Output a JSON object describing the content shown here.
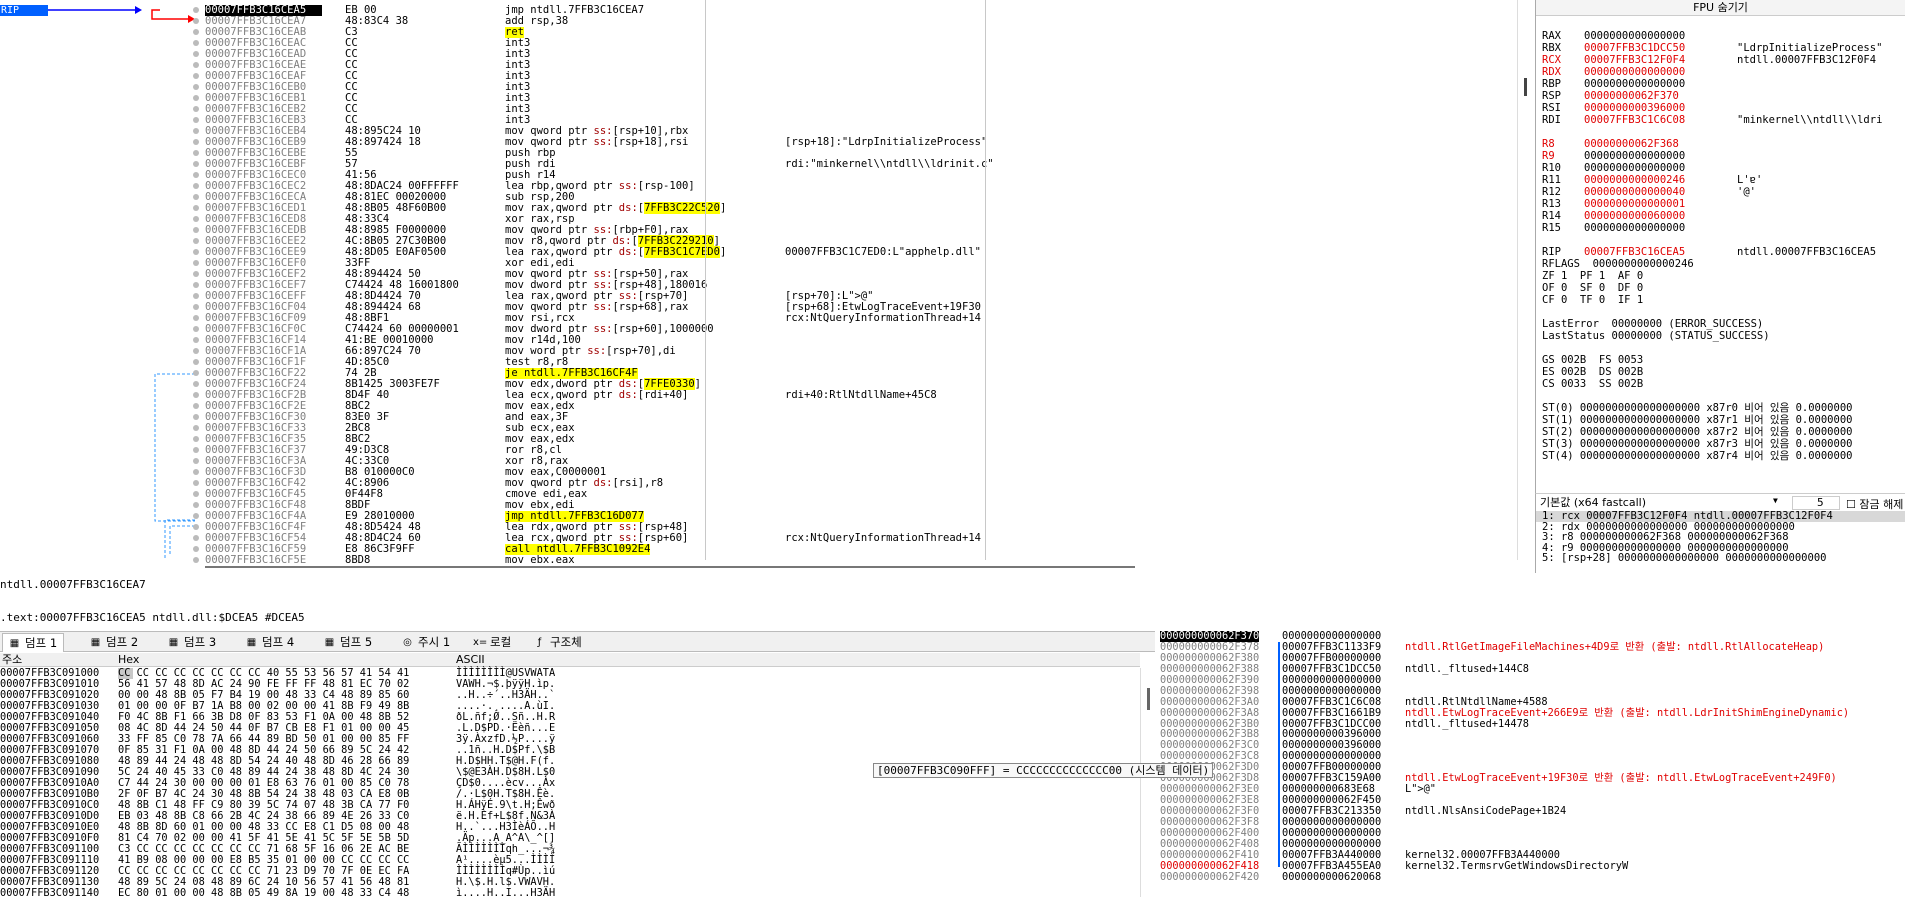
{
  "disasm": {
    "eip_label": "RIP",
    "rows": [
      {
        "addr": "00007FFB3C16CEA5",
        "bytes": "EB 00",
        "instr": "jmp ntdll.7FFB3C16CEA7",
        "cmt": "",
        "cur": true,
        "hl": ""
      },
      {
        "addr": "00007FFB3C16CEA7",
        "bytes": "48:83C4 38",
        "instr": "add rsp,38",
        "cmt": "",
        "hl": ""
      },
      {
        "addr": "00007FFB3C16CEAB",
        "bytes": "C3",
        "instr": "ret",
        "cmt": "",
        "hl": "ret"
      },
      {
        "addr": "00007FFB3C16CEAC",
        "bytes": "CC",
        "instr": "int3",
        "cmt": "",
        "hl": ""
      },
      {
        "addr": "00007FFB3C16CEAD",
        "bytes": "CC",
        "instr": "int3",
        "cmt": "",
        "hl": ""
      },
      {
        "addr": "00007FFB3C16CEAE",
        "bytes": "CC",
        "instr": "int3",
        "cmt": "",
        "hl": ""
      },
      {
        "addr": "00007FFB3C16CEAF",
        "bytes": "CC",
        "instr": "int3",
        "cmt": "",
        "hl": ""
      },
      {
        "addr": "00007FFB3C16CEB0",
        "bytes": "CC",
        "instr": "int3",
        "cmt": "",
        "hl": ""
      },
      {
        "addr": "00007FFB3C16CEB1",
        "bytes": "CC",
        "instr": "int3",
        "cmt": "",
        "hl": ""
      },
      {
        "addr": "00007FFB3C16CEB2",
        "bytes": "CC",
        "instr": "int3",
        "cmt": "",
        "hl": ""
      },
      {
        "addr": "00007FFB3C16CEB3",
        "bytes": "CC",
        "instr": "int3",
        "cmt": "",
        "hl": ""
      },
      {
        "addr": "00007FFB3C16CEB4",
        "bytes": "48:895C24 10",
        "instr": "mov qword ptr ss:[rsp+10],rbx",
        "cmt": "",
        "hl": ""
      },
      {
        "addr": "00007FFB3C16CEB9",
        "bytes": "48:897424 18",
        "instr": "mov qword ptr ss:[rsp+18],rsi",
        "cmt": "[rsp+18]:\"LdrpInitializeProcess\"",
        "hl": ""
      },
      {
        "addr": "00007FFB3C16CEBE",
        "bytes": "55",
        "instr": "push rbp",
        "cmt": "",
        "hl": ""
      },
      {
        "addr": "00007FFB3C16CEBF",
        "bytes": "57",
        "instr": "push rdi",
        "cmt": "rdi:\"minkernel\\\\ntdll\\\\ldrinit.c\"",
        "hl": ""
      },
      {
        "addr": "00007FFB3C16CEC0",
        "bytes": "41:56",
        "instr": "push r14",
        "cmt": "",
        "hl": ""
      },
      {
        "addr": "00007FFB3C16CEC2",
        "bytes": "48:8DAC24 00FFFFFF",
        "instr": "lea rbp,qword ptr ss:[rsp-100]",
        "cmt": "",
        "hl": ""
      },
      {
        "addr": "00007FFB3C16CECA",
        "bytes": "48:81EC 00020000",
        "instr": "sub rsp,200",
        "cmt": "",
        "hl": ""
      },
      {
        "addr": "00007FFB3C16CED1",
        "bytes": "48:8B05 48F60B00",
        "instr": "mov rax,qword ptr ds:[7FFB3C22C520]",
        "cmt": "",
        "hl": ""
      },
      {
        "addr": "00007FFB3C16CED8",
        "bytes": "48:33C4",
        "instr": "xor rax,rsp",
        "cmt": "",
        "hl": ""
      },
      {
        "addr": "00007FFB3C16CEDB",
        "bytes": "48:8985 F0000000",
        "instr": "mov qword ptr ss:[rbp+F0],rax",
        "cmt": "",
        "hl": ""
      },
      {
        "addr": "00007FFB3C16CEE2",
        "bytes": "4C:8B05 27C30B00",
        "instr": "mov r8,qword ptr ds:[7FFB3C229210]",
        "cmt": "",
        "hl": ""
      },
      {
        "addr": "00007FFB3C16CEE9",
        "bytes": "48:8D05 E0AF0500",
        "instr": "lea rax,qword ptr ds:[7FFB3C1C7ED0]",
        "cmt": "00007FFB3C1C7ED0:L\"apphelp.dll\"",
        "hl": ""
      },
      {
        "addr": "00007FFB3C16CEF0",
        "bytes": "33FF",
        "instr": "xor edi,edi",
        "cmt": "",
        "hl": ""
      },
      {
        "addr": "00007FFB3C16CEF2",
        "bytes": "48:894424 50",
        "instr": "mov qword ptr ss:[rsp+50],rax",
        "cmt": "",
        "hl": ""
      },
      {
        "addr": "00007FFB3C16CEF7",
        "bytes": "C74424 48 16001800",
        "instr": "mov dword ptr ss:[rsp+48],180016",
        "cmt": "",
        "hl": ""
      },
      {
        "addr": "00007FFB3C16CEFF",
        "bytes": "48:8D4424 70",
        "instr": "lea rax,qword ptr ss:[rsp+70]",
        "cmt": "[rsp+70]:L\">@\"",
        "hl": ""
      },
      {
        "addr": "00007FFB3C16CF04",
        "bytes": "48:894424 68",
        "instr": "mov qword ptr ss:[rsp+68],rax",
        "cmt": "[rsp+68]:EtwLogTraceEvent+19F30",
        "hl": ""
      },
      {
        "addr": "00007FFB3C16CF09",
        "bytes": "48:8BF1",
        "instr": "mov rsi,rcx",
        "cmt": "rcx:NtQueryInformationThread+14",
        "hl": ""
      },
      {
        "addr": "00007FFB3C16CF0C",
        "bytes": "C74424 60 00000001",
        "instr": "mov dword ptr ss:[rsp+60],1000000",
        "cmt": "",
        "hl": ""
      },
      {
        "addr": "00007FFB3C16CF14",
        "bytes": "41:BE 00010000",
        "instr": "mov r14d,100",
        "cmt": "",
        "hl": ""
      },
      {
        "addr": "00007FFB3C16CF1A",
        "bytes": "66:897C24 70",
        "instr": "mov word ptr ss:[rsp+70],di",
        "cmt": "",
        "hl": ""
      },
      {
        "addr": "00007FFB3C16CF1F",
        "bytes": "4D:85C0",
        "instr": "test r8,r8",
        "cmt": "",
        "hl": ""
      },
      {
        "addr": "00007FFB3C16CF22",
        "bytes": "74 2B",
        "instr": "je ntdll.7FFB3C16CF4F",
        "cmt": "",
        "hl": "je"
      },
      {
        "addr": "00007FFB3C16CF24",
        "bytes": "8B1425 3003FE7F",
        "instr": "mov edx,dword ptr ds:[7FFE0330]",
        "cmt": "",
        "hl": ""
      },
      {
        "addr": "00007FFB3C16CF2B",
        "bytes": "8D4F 40",
        "instr": "lea ecx,qword ptr ds:[rdi+40]",
        "cmt": "rdi+40:RtlNtdllName+45C8",
        "hl": ""
      },
      {
        "addr": "00007FFB3C16CF2E",
        "bytes": "8BC2",
        "instr": "mov eax,edx",
        "cmt": "",
        "hl": ""
      },
      {
        "addr": "00007FFB3C16CF30",
        "bytes": "83E0 3F",
        "instr": "and eax,3F",
        "cmt": "",
        "hl": ""
      },
      {
        "addr": "00007FFB3C16CF33",
        "bytes": "2BC8",
        "instr": "sub ecx,eax",
        "cmt": "",
        "hl": ""
      },
      {
        "addr": "00007FFB3C16CF35",
        "bytes": "8BC2",
        "instr": "mov eax,edx",
        "cmt": "",
        "hl": ""
      },
      {
        "addr": "00007FFB3C16CF37",
        "bytes": "49:D3C8",
        "instr": "ror r8,cl",
        "cmt": "",
        "hl": ""
      },
      {
        "addr": "00007FFB3C16CF3A",
        "bytes": "4C:33C0",
        "instr": "xor r8,rax",
        "cmt": "",
        "hl": ""
      },
      {
        "addr": "00007FFB3C16CF3D",
        "bytes": "B8 010000C0",
        "instr": "mov eax,C0000001",
        "cmt": "",
        "hl": ""
      },
      {
        "addr": "00007FFB3C16CF42",
        "bytes": "4C:8906",
        "instr": "mov qword ptr ds:[rsi],r8",
        "cmt": "",
        "hl": ""
      },
      {
        "addr": "00007FFB3C16CF45",
        "bytes": "0F44F8",
        "instr": "cmove edi,eax",
        "cmt": "",
        "hl": ""
      },
      {
        "addr": "00007FFB3C16CF48",
        "bytes": "8BDF",
        "instr": "mov ebx,edi",
        "cmt": "",
        "hl": ""
      },
      {
        "addr": "00007FFB3C16CF4A",
        "bytes": "E9 28010000",
        "instr": "jmp ntdll.7FFB3C16D077",
        "cmt": "",
        "hl": "jmp"
      },
      {
        "addr": "00007FFB3C16CF4F",
        "bytes": "48:8D5424 48",
        "instr": "lea rdx,qword ptr ss:[rsp+48]",
        "cmt": "",
        "hl": ""
      },
      {
        "addr": "00007FFB3C16CF54",
        "bytes": "48:8D4C24 60",
        "instr": "lea rcx,qword ptr ss:[rsp+60]",
        "cmt": "rcx:NtQueryInformationThread+14",
        "hl": ""
      },
      {
        "addr": "00007FFB3C16CF59",
        "bytes": "E8 86C3F9FF",
        "instr": "call ntdll.7FFB3C1092E4",
        "cmt": "",
        "hl": "call"
      },
      {
        "addr": "00007FFB3C16CF5E",
        "bytes": "8BD8",
        "instr": "mov ebx,eax",
        "cmt": "",
        "hl": ""
      }
    ]
  },
  "info": {
    "line1": "ntdll.00007FFB3C16CEA7",
    "line2": ".text:00007FFB3C16CEA5 ntdll.dll:$DCEA5 #DCEA5"
  },
  "regs": {
    "title": "FPU 숨기기",
    "rows": [
      {
        "n": "RAX",
        "v": "0000000000000000",
        "c": "",
        "red": false
      },
      {
        "n": "RBX",
        "v": "00007FFB3C1DCC50",
        "c": "\"LdrpInitializeProcess\"",
        "red": true
      },
      {
        "n": "RCX",
        "v": "00007FFB3C12F0F4",
        "c": "ntdll.00007FFB3C12F0F4",
        "red": true,
        "nred": true
      },
      {
        "n": "RDX",
        "v": "0000000000000000",
        "c": "",
        "red": true,
        "nred": true
      },
      {
        "n": "RBP",
        "v": "0000000000000000",
        "c": "",
        "red": false
      },
      {
        "n": "RSP",
        "v": "00000000062F370",
        "c": "",
        "red": true
      },
      {
        "n": "RSI",
        "v": "0000000000396000",
        "c": "",
        "red": true
      },
      {
        "n": "RDI",
        "v": "00007FFB3C1C6C08",
        "c": "\"minkernel\\\\ntdll\\\\ldri",
        "red": true
      },
      {
        "n": "",
        "v": "",
        "c": ""
      },
      {
        "n": "R8",
        "v": "00000000062F368",
        "c": "",
        "red": true,
        "nred": true
      },
      {
        "n": "R9",
        "v": "0000000000000000",
        "c": "",
        "red": false,
        "nred": true
      },
      {
        "n": "R10",
        "v": "0000000000000000",
        "c": "",
        "red": false
      },
      {
        "n": "R11",
        "v": "0000000000000246",
        "c": "L'ɐ'",
        "red": true
      },
      {
        "n": "R12",
        "v": "0000000000000040",
        "c": "'@'",
        "red": true
      },
      {
        "n": "R13",
        "v": "0000000000000001",
        "c": "",
        "red": true
      },
      {
        "n": "R14",
        "v": "0000000000060000",
        "c": "",
        "red": true
      },
      {
        "n": "R15",
        "v": "0000000000000000",
        "c": "",
        "red": false
      },
      {
        "n": "",
        "v": "",
        "c": ""
      },
      {
        "n": "RIP",
        "v": "00007FFB3C16CEA5",
        "c": "ntdll.00007FFB3C16CEA5",
        "red": true
      }
    ],
    "flags": [
      "RFLAGS  0000000000000246",
      "ZF 1  PF 1  AF 0",
      "OF 0  SF 0  DF 0",
      "CF 0  TF 0  IF 1",
      "",
      "LastError  00000000 (ERROR_SUCCESS)",
      "LastStatus 00000000 (STATUS_SUCCESS)",
      "",
      "GS 002B  FS 0053",
      "ES 002B  DS 002B",
      "CS 0033  SS 002B",
      "",
      "ST(0) 0000000000000000000 x87r0 비어 있음 0.0000000",
      "ST(1) 0000000000000000000 x87r1 비어 있음 0.0000000",
      "ST(2) 0000000000000000000 x87r2 비어 있음 0.0000000",
      "ST(3) 0000000000000000000 x87r3 비어 있음 0.0000000",
      "ST(4) 0000000000000000000 x87r4 비어 있음 0.0000000"
    ]
  },
  "callconv": {
    "selected": "기본값 (x64 fastcall)",
    "count": "5",
    "lock_label": "잠금 해제됨",
    "rows": [
      "1: rcx 00007FFB3C12F0F4 ntdll.00007FFB3C12F0F4",
      "2: rdx 0000000000000000 0000000000000000",
      "3: r8 000000000062F368 000000000062F368",
      "4: r9 0000000000000000 0000000000000000",
      "5: [rsp+28] 0000000000000000 0000000000000000"
    ]
  },
  "tabs": [
    {
      "label": "덤프 1",
      "icon": "▦"
    },
    {
      "label": "덤프 2",
      "icon": "▦"
    },
    {
      "label": "덤프 3",
      "icon": "▦"
    },
    {
      "label": "덤프 4",
      "icon": "▦"
    },
    {
      "label": "덤프 5",
      "icon": "▦"
    },
    {
      "label": "주시 1",
      "icon": "◎"
    },
    {
      "label": "로컬",
      "icon": "x="
    },
    {
      "label": "구조체",
      "icon": "ƒ"
    }
  ],
  "dump": {
    "headers": {
      "addr": "주소",
      "hex": "Hex",
      "ascii": "ASCII"
    },
    "rows": [
      {
        "a": "00007FFB3C091000",
        "h": "CC CC CC CC CC CC CC CC 40 55 53 56 57 41 54 41",
        "s": "ÌÌÌÌÌÌÌÌ@USVWATA"
      },
      {
        "a": "00007FFB3C091010",
        "h": "56 41 57 48 8D AC 24 90 FE FF FF 48 81 EC 70 02",
        "s": "VAWH.¬$.þÿÿH.ìp."
      },
      {
        "a": "00007FFB3C091020",
        "h": "00 00 48 8B 05 F7 B4 19 00 48 33 C4 48 89 85 60",
        "s": "..H..÷´..H3ÄH..`"
      },
      {
        "a": "00007FFB3C091030",
        "h": "01 00 00 0F B7 1A B8 00 02 00 00 41 8B F9 49 8B",
        "s": "....·.¸....A.ùI."
      },
      {
        "a": "00007FFB3C091040",
        "h": "F0 4C 8B F1 66 3B D8 0F 83 53 F1 0A 00 48 8B 52",
        "s": "ðL.ñf;Ø..Sñ..H.R"
      },
      {
        "a": "00007FFB3C091050",
        "h": "08 4C 8D 44 24 50 44 0F B7 CB E8 F1 01 00 00 45",
        "s": ".L.D$PD.·Ëèñ...E"
      },
      {
        "a": "00007FFB3C091060",
        "h": "33 FF 85 C0 78 7A 66 44 89 BD 50 01 00 00 85 FF",
        "s": "3ÿ.ÀxzfD.½P....ÿ"
      },
      {
        "a": "00007FFB3C091070",
        "h": "0F 85 31 F1 0A 00 48 8D 44 24 50 66 89 5C 24 42",
        "s": "..1ñ..H.D$Pf.\\$B"
      },
      {
        "a": "00007FFB3C091080",
        "h": "48 89 44 24 48 48 8D 54 24 40 48 8D 46 28 66 89",
        "s": "H.D$HH.T$@H.F(f."
      },
      {
        "a": "00007FFB3C091090",
        "h": "5C 24 40 45 33 C0 48 89 44 24 38 48 8D 4C 24 30",
        "s": "\\$@E3ÀH.D$8H.L$0"
      },
      {
        "a": "00007FFB3C0910A0",
        "h": "C7 44 24 30 00 00 00 01 E8 63 76 01 00 85 C0 78",
        "s": "ÇD$0....ècv...Àx"
      },
      {
        "a": "00007FFB3C0910B0",
        "h": "2F 0F B7 4C 24 30 48 8B 54 24 38 48 03 CA E8 0B",
        "s": "/.·L$0H.T$8H.Êè."
      },
      {
        "a": "00007FFB3C0910C0",
        "h": "48 8B C1 48 FF C9 80 39 5C 74 07 48 3B CA 77 F0",
        "s": "H.ÁHÿÉ.9\\t.H;Êwð"
      },
      {
        "a": "00007FFB3C0910D0",
        "h": "EB 03 48 8B C8 66 2B 4C 24 38 66 89 4E 26 33 C0",
        "s": "ë.H.Èf+L$8f.N&3À"
      },
      {
        "a": "00007FFB3C0910E0",
        "h": "48 8B 8D 60 01 00 00 48 33 CC E8 C1 D5 08 00 48",
        "s": "H..`...H3ÌèÁÕ..H"
      },
      {
        "a": "00007FFB3C0910F0",
        "h": "81 C4 70 02 00 00 41 5F 41 5E 41 5C 5F 5E 5B 5D",
        "s": ".Äp...A_A^A\\_^[]"
      },
      {
        "a": "00007FFB3C091100",
        "h": "C3 CC CC CC CC CC CC CC 71 68 5F 16 06 2E AC BE",
        "s": "ÃÌÌÌÌÌÌÌqh_...¬¾"
      },
      {
        "a": "00007FFB3C091110",
        "h": "41 B9 08 00 00 00 E8 B5 35 01 00 00 CC CC CC CC",
        "s": "A¹....èµ5...ÌÌÌÌ"
      },
      {
        "a": "00007FFB3C091120",
        "h": "CC CC CC CC CC CC CC CC 71 23 D9 70 7F 0E EC FA",
        "s": "ÌÌÌÌÌÌÌÌq#Ùp..ìú"
      },
      {
        "a": "00007FFB3C091130",
        "h": "48 89 5C 24 08 48 89 6C 24 10 56 57 41 56 48 81",
        "s": "H.\\$.H.l$.VWAVH."
      },
      {
        "a": "00007FFB3C091140",
        "h": "EC 80 01 00 00 48 8B 05 49 8A 19 00 48 33 C4 48",
        "s": "ì....H..I...H3ÄH"
      }
    ]
  },
  "tooltip": "[00007FFB3C090FFF] = CCCCCCCCCCCCCC00 (시스템 데이터)",
  "stack": {
    "rows": [
      {
        "a": "000000000062F370",
        "v": "0000000000000000",
        "c": "",
        "cur": true,
        "red": false
      },
      {
        "a": "000000000062F378",
        "v": "00007FFB3C1133F9",
        "c": "ntdll.RtlGetImageFileMachines+4D9로 반환 (출발: ntdll.RtlAllocateHeap)",
        "red": true
      },
      {
        "a": "000000000062F380",
        "v": "00007FFB00000000",
        "c": "",
        "red": false
      },
      {
        "a": "000000000062F388",
        "v": "00007FFB3C1DCC50",
        "c": "ntdll._fltused+144C8",
        "red": false
      },
      {
        "a": "000000000062F390",
        "v": "0000000000000000",
        "c": "",
        "red": false
      },
      {
        "a": "000000000062F398",
        "v": "0000000000000000",
        "c": "",
        "red": false
      },
      {
        "a": "000000000062F3A0",
        "v": "00007FFB3C1C6C08",
        "c": "ntdll.RtlNtdllName+4588",
        "red": false
      },
      {
        "a": "000000000062F3A8",
        "v": "00007FFB3C1661B9",
        "c": "ntdll.EtwLogTraceEvent+266E9로 반환 (출발: ntdll.LdrInitShimEngineDynamic)",
        "red": true
      },
      {
        "a": "000000000062F3B0",
        "v": "00007FFB3C1DCC00",
        "c": "ntdll._fltused+14478",
        "red": false
      },
      {
        "a": "000000000062F3B8",
        "v": "0000000000396000",
        "c": "",
        "red": false
      },
      {
        "a": "000000000062F3C0",
        "v": "0000000000396000",
        "c": "",
        "red": false
      },
      {
        "a": "000000000062F3C8",
        "v": "0000000000000000",
        "c": "",
        "red": false
      },
      {
        "a": "000000000062F3D0",
        "v": "00007FFB00000000",
        "c": "",
        "red": false
      },
      {
        "a": "000000000062F3D8",
        "v": "00007FFB3C159A00",
        "c": "ntdll.EtwLogTraceEvent+19F30로 반환 (출발: ntdll.EtwLogTraceEvent+249F0)",
        "red": true
      },
      {
        "a": "000000000062F3E0",
        "v": "000000000683E68",
        "c": "L\">@\"",
        "red": false
      },
      {
        "a": "000000000062F3E8",
        "v": "000000000062F450",
        "c": "",
        "red": false
      },
      {
        "a": "000000000062F3F0",
        "v": "00007FFB3C213350",
        "c": "ntdll.NlsAnsiCodePage+1B24",
        "red": false
      },
      {
        "a": "000000000062F3F8",
        "v": "0000000000000000",
        "c": "",
        "red": false
      },
      {
        "a": "000000000062F400",
        "v": "0000000000000000",
        "c": "",
        "red": false
      },
      {
        "a": "000000000062F408",
        "v": "0000000000000000",
        "c": "",
        "red": false
      },
      {
        "a": "000000000062F410",
        "v": "00007FFB3A440000",
        "c": "kernel32.00007FFB3A440000",
        "red": false
      },
      {
        "a": "000000000062F418",
        "v": "00007FFB3A455EA0",
        "c": "kernel32.TermsrvGetWindowsDirectoryW",
        "red": false,
        "ared": true
      },
      {
        "a": "000000000062F420",
        "v": "0000000000620068",
        "c": "",
        "red": false
      }
    ]
  }
}
